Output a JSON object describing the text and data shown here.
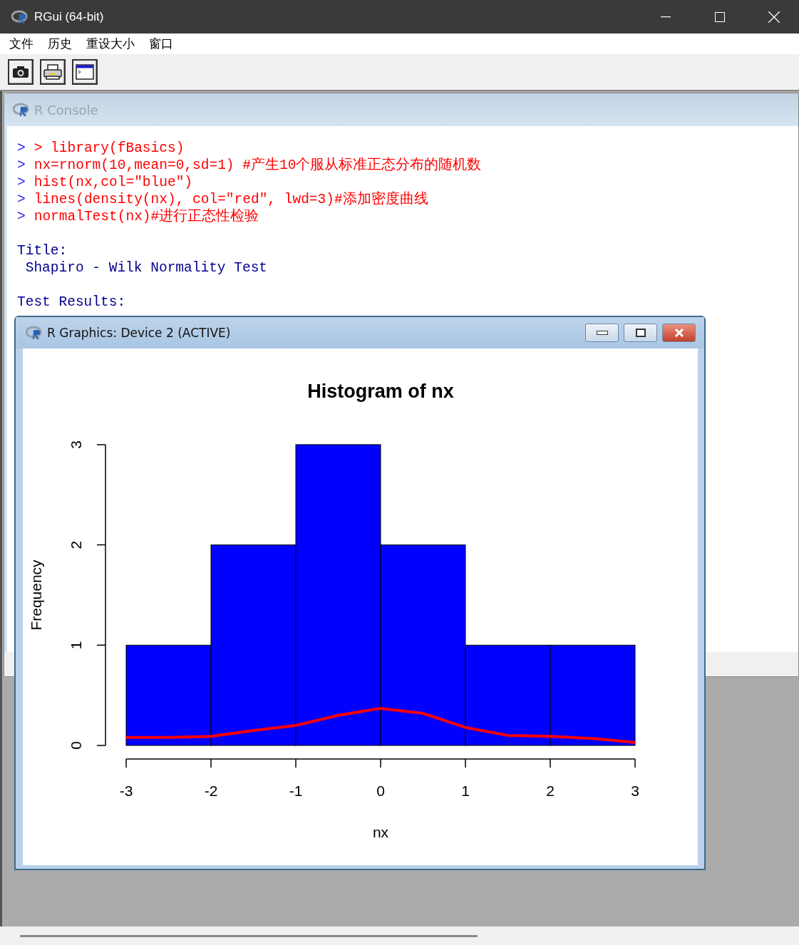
{
  "window": {
    "title": "RGui (64-bit)"
  },
  "menu": [
    "文件",
    "历史",
    "重设大小",
    "窗口"
  ],
  "toolbar": [
    {
      "kind": "camera"
    },
    {
      "kind": "print"
    },
    {
      "kind": "console"
    }
  ],
  "console": {
    "title": "R Console",
    "lines": [
      {
        "kind": "input",
        "prompt": ">",
        "text": "> library(fBasics)"
      },
      {
        "kind": "input",
        "prompt": ">",
        "text": "nx=rnorm(10,mean=0,sd=1) #产生10个服从标准正态分布的随机数"
      },
      {
        "kind": "input",
        "prompt": ">",
        "text": "hist(nx,col=\"blue\")"
      },
      {
        "kind": "input",
        "prompt": ">",
        "text": "lines(density(nx), col=\"red\", lwd=3)#添加密度曲线"
      },
      {
        "kind": "input",
        "prompt": ">",
        "text": "normalTest(nx)#进行正态性检验"
      },
      {
        "kind": "blank"
      },
      {
        "kind": "output",
        "text": "Title:"
      },
      {
        "kind": "output",
        "text": " Shapiro - Wilk Normality Test"
      },
      {
        "kind": "blank"
      },
      {
        "kind": "output",
        "text": "Test Results:"
      }
    ]
  },
  "graphics": {
    "title": "R Graphics: Device 2 (ACTIVE)",
    "chart_data": {
      "type": "bar",
      "title": "Histogram of nx",
      "xlabel": "nx",
      "ylabel": "Frequency",
      "x": [
        -3,
        -2.5,
        -2,
        -1.5,
        -1,
        -0.5,
        0,
        0.5,
        1,
        1.5,
        2,
        2.5,
        3
      ],
      "series": [
        {
          "type": "bar",
          "color": "#0000ff",
          "values": [
            null,
            1,
            null,
            2,
            null,
            3,
            null,
            2,
            null,
            1,
            null,
            1,
            null
          ]
        },
        {
          "type": "line",
          "color": "#ff0000",
          "values": [
            0.08,
            0.08,
            0.09,
            0.15,
            0.2,
            0.3,
            0.37,
            0.32,
            0.18,
            0.1,
            0.09,
            0.07,
            0.03
          ]
        }
      ],
      "xlim": [
        -3,
        3
      ],
      "ylim": [
        0,
        3
      ],
      "xticks": [
        -3,
        -2,
        -1,
        0,
        1,
        2,
        3
      ],
      "yticks": [
        0,
        1,
        2,
        3
      ]
    }
  }
}
